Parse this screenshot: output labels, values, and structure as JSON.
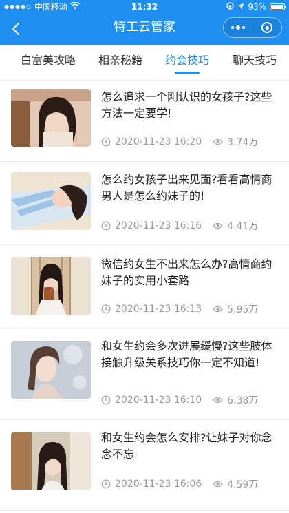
{
  "status_bar": {
    "carrier": "中国移动",
    "time": "11:32",
    "battery": "93%",
    "battery_level": 0.93
  },
  "nav": {
    "title": "特工云管家",
    "back_icon": "chevron-left-icon",
    "more_icon": "more-dots-icon",
    "close_icon": "close-target-icon"
  },
  "tabs": [
    {
      "label": "白富美攻略",
      "active": false
    },
    {
      "label": "相亲秘籍",
      "active": false
    },
    {
      "label": "约会技巧",
      "active": true
    },
    {
      "label": "聊天技巧",
      "active": false
    }
  ],
  "accent_color": "#1e8ef0",
  "articles": [
    {
      "title": "怎么追求一个刚认识的女孩子?这些方法一定要学!",
      "time": "2020-11-23 16:20",
      "views": "3.74万"
    },
    {
      "title": "怎么约女孩子出来见面?看看高情商男人是怎么约妹子的!",
      "time": "2020-11-23 16:16",
      "views": "4.41万"
    },
    {
      "title": "微信约女生不出来怎么办?高情商约妹子的实用小套路",
      "time": "2020-11-23 16:13",
      "views": "5.95万"
    },
    {
      "title": "和女生约会多次进展缓慢?这些肢体接触升级关系技巧你一定不知道!",
      "time": "2020-11-23 16:10",
      "views": "6.38万"
    },
    {
      "title": "和女生约会怎么安排?让妹子对你念念不忘",
      "time": "2020-11-23 16:06",
      "views": "4.59万"
    }
  ]
}
